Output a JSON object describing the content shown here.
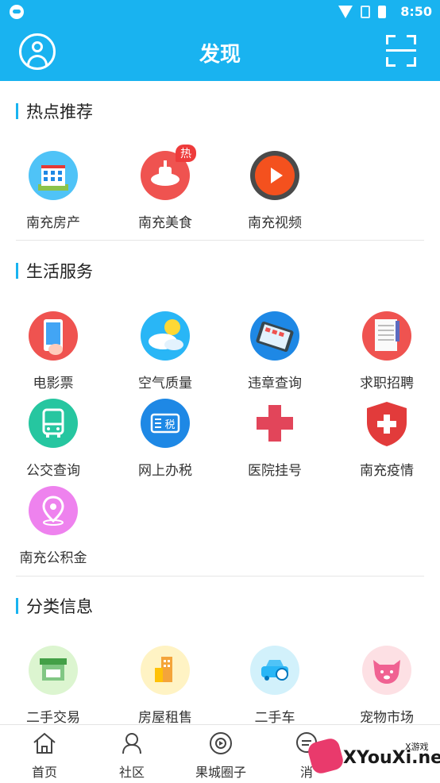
{
  "status_bar": {
    "time": "8:50"
  },
  "header": {
    "title": "发现"
  },
  "sections": {
    "hot": {
      "title": "热点推荐",
      "items": [
        {
          "label": "南充房产",
          "icon": "building-icon"
        },
        {
          "label": "南充美食",
          "icon": "hotpot-icon",
          "badge": "热"
        },
        {
          "label": "南充视频",
          "icon": "play-icon"
        }
      ]
    },
    "life": {
      "title": "生活服务",
      "items": [
        {
          "label": "电影票",
          "icon": "phone-hand-icon"
        },
        {
          "label": "空气质量",
          "icon": "weather-icon"
        },
        {
          "label": "违章查询",
          "icon": "tablet-icon"
        },
        {
          "label": "求职招聘",
          "icon": "resume-icon"
        },
        {
          "label": "公交查询",
          "icon": "bus-icon"
        },
        {
          "label": "网上办税",
          "icon": "tax-icon",
          "icon_text": "税"
        },
        {
          "label": "医院挂号",
          "icon": "medical-cross-icon"
        },
        {
          "label": "南充疫情",
          "icon": "shield-cross-icon"
        },
        {
          "label": "南充公积金",
          "icon": "location-pin-icon"
        }
      ]
    },
    "classified": {
      "title": "分类信息",
      "items": [
        {
          "label": "二手交易",
          "icon": "market-stall-icon"
        },
        {
          "label": "房屋租售",
          "icon": "house-icon"
        },
        {
          "label": "二手车",
          "icon": "car-icon"
        },
        {
          "label": "宠物市场",
          "icon": "pet-icon"
        }
      ]
    }
  },
  "tabbar": {
    "tabs": [
      {
        "label": "首页",
        "icon": "home-icon"
      },
      {
        "label": "社区",
        "icon": "community-icon"
      },
      {
        "label": "果城圈子",
        "icon": "circle-icon"
      },
      {
        "label": "消",
        "icon": "message-icon"
      }
    ]
  },
  "watermark": {
    "text": "XYouXi.net",
    "small": "X游戏"
  },
  "colors": {
    "accent": "#19b3f0"
  }
}
